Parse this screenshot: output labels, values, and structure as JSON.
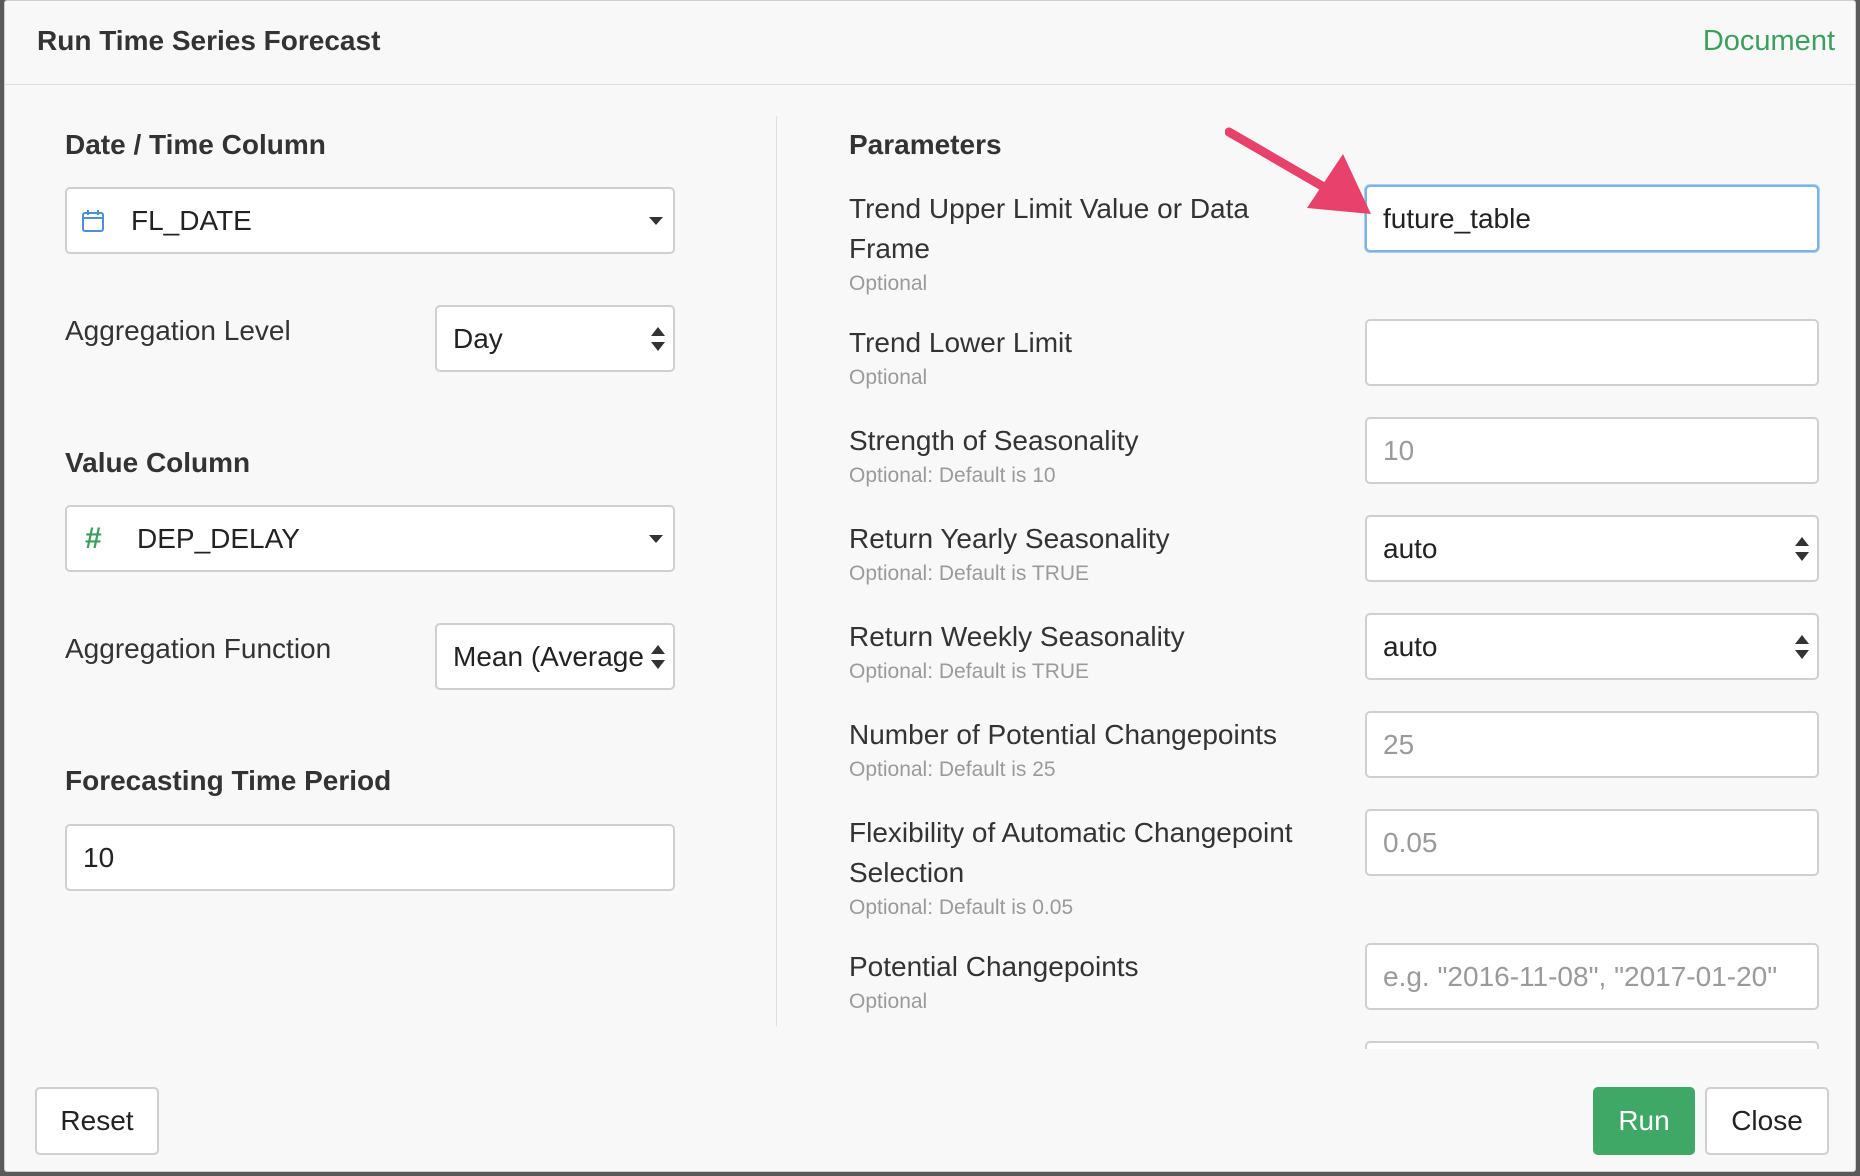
{
  "dialog": {
    "title": "Run Time Series Forecast",
    "document_link": "Document"
  },
  "left": {
    "date_section": "Date / Time Column",
    "date_value": "FL_DATE",
    "aggregation_level_label": "Aggregation Level",
    "aggregation_level_value": "Day",
    "value_section": "Value Column",
    "value_column": "DEP_DELAY",
    "aggregation_function_label": "Aggregation Function",
    "aggregation_function_value": "Mean (Average)",
    "forecast_section": "Forecasting Time Period",
    "forecast_value": "10"
  },
  "params": {
    "heading": "Parameters",
    "items": [
      {
        "label": "Trend Upper Limit Value or Data Frame",
        "hint": "Optional",
        "value": "future_table"
      },
      {
        "label": "Trend Lower Limit",
        "hint": "Optional",
        "value": ""
      },
      {
        "label": "Strength of Seasonality",
        "hint": "Optional: Default is 10",
        "placeholder": "10"
      },
      {
        "label": "Return Yearly Seasonality",
        "hint": "Optional: Default is TRUE",
        "value": "auto"
      },
      {
        "label": "Return Weekly Seasonality",
        "hint": "Optional: Default is TRUE",
        "value": "auto"
      },
      {
        "label": "Number of Potential Changepoints",
        "hint": "Optional: Default is 25",
        "placeholder": "25"
      },
      {
        "label": "Flexibility of Automatic Changepoint Selection",
        "hint": "Optional: Default is 0.05",
        "placeholder": "0.05"
      },
      {
        "label": "Potential Changepoints",
        "hint": "Optional",
        "placeholder": "e.g. \"2016-11-08\", \"2017-01-20\""
      }
    ]
  },
  "footer": {
    "reset": "Reset",
    "run": "Run",
    "close": "Close"
  },
  "colors": {
    "accent_green": "#3fa866",
    "arrow_pink": "#e8416b",
    "focus_blue": "#7fb2e6"
  },
  "icons": [
    "calendar-icon",
    "hash-icon",
    "arrow-annotation"
  ]
}
